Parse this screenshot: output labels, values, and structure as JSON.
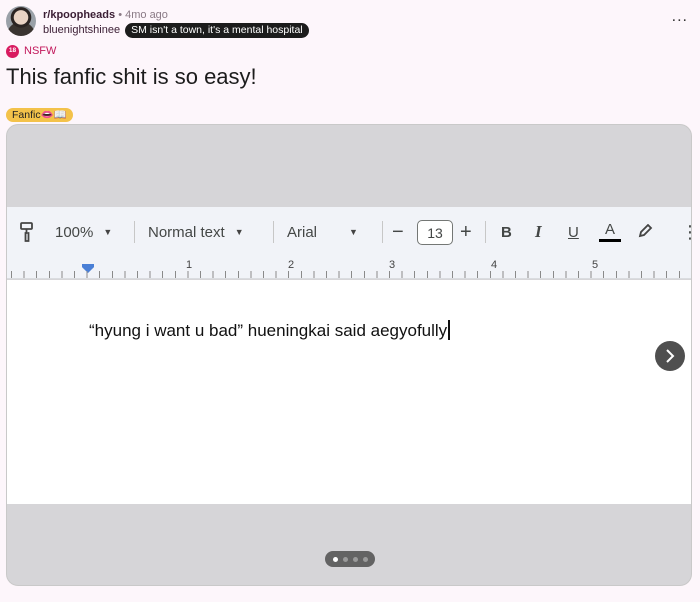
{
  "post": {
    "subreddit": "r/kpoopheads",
    "age": "4mo ago",
    "username": "bluenightshinee",
    "user_flair": "SM isn't a town, it's a mental hospital",
    "nsfw_label": "NSFW",
    "nsfw_badge": "18",
    "title": "This fanfic shit is so easy!",
    "post_flair": "Fanfic👄📖",
    "more_label": "..."
  },
  "gallery": {
    "toolbar": {
      "zoom": "100%",
      "style": "Normal text",
      "font": "Arial",
      "minus": "−",
      "font_size": "13",
      "plus": "+",
      "bold": "B",
      "italic": "I",
      "underline": "U",
      "text_color": "A",
      "more": "⋮"
    },
    "ruler": [
      "1",
      "2",
      "3",
      "4",
      "5"
    ],
    "document_text": "“hyung i want u bad” hueningkai said aegyofully",
    "page_count": 4,
    "current_page": 1
  },
  "colors": {
    "background": "#fdf6fb",
    "nsfw": "#d81b60",
    "post_flair": "#f3c24a",
    "user_flair": "#1c1c1c"
  }
}
